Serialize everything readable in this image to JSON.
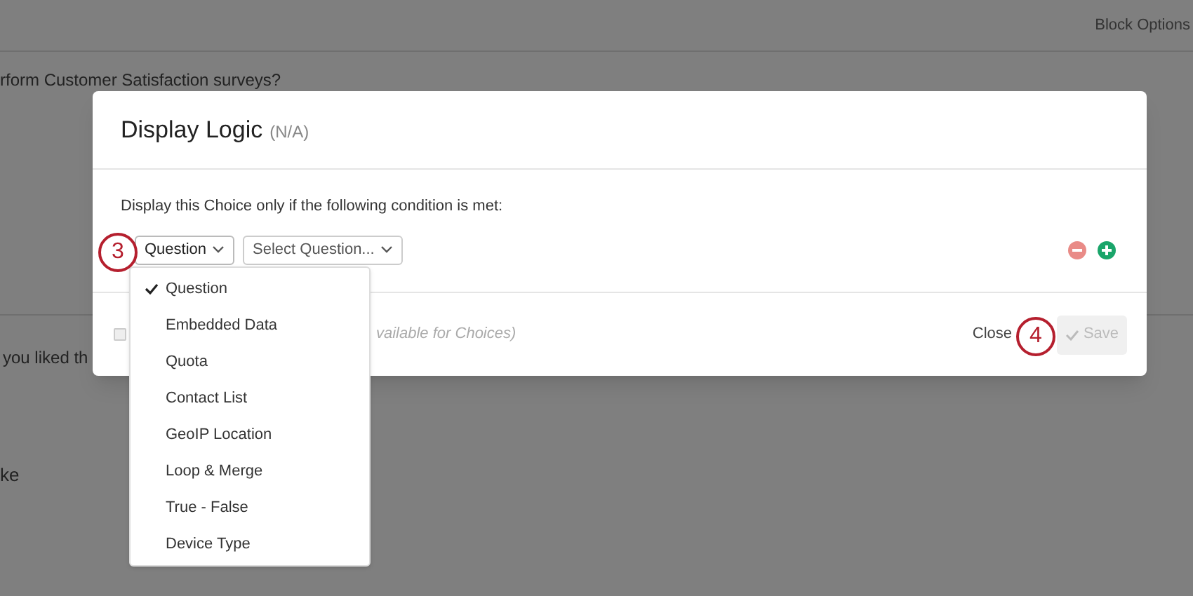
{
  "background": {
    "block_options": "Block Options",
    "question_1": "rform Customer Satisfaction surveys?",
    "question_2": "you liked th",
    "question_3": "ke"
  },
  "modal": {
    "title": "Display Logic",
    "subtitle": "(N/A)",
    "instruction": "Display this Choice only if the following condition is met:",
    "type_select": {
      "value": "Question"
    },
    "question_select": {
      "placeholder": "Select Question..."
    },
    "footer": {
      "checkbox": {
        "checked": false
      },
      "note": "vailable for Choices)",
      "close": "Close",
      "save": {
        "label": "Save",
        "disabled": true
      }
    }
  },
  "dropdown": [
    {
      "label": "Question",
      "selected": true
    },
    {
      "label": "Embedded Data",
      "selected": false
    },
    {
      "label": "Quota",
      "selected": false
    },
    {
      "label": "Contact List",
      "selected": false
    },
    {
      "label": "GeoIP Location",
      "selected": false
    },
    {
      "label": "Loop & Merge",
      "selected": false
    },
    {
      "label": "True - False",
      "selected": false
    },
    {
      "label": "Device Type",
      "selected": false
    }
  ],
  "callouts": [
    "3",
    "4"
  ]
}
